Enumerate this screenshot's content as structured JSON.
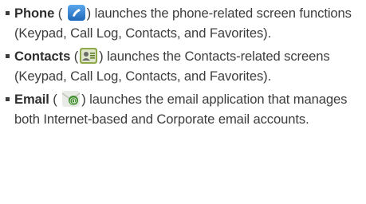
{
  "items": [
    {
      "term": "Phone",
      "open": " ( ",
      "icon": "phone-app-icon",
      "description": ") launches the phone-related screen functions (Keypad, Call Log, Contacts, and Favorites)."
    },
    {
      "term": "Contacts",
      "open": " (",
      "icon": "contacts-app-icon",
      "description": ") launches the Contacts-related screens (Keypad, Call Log, Contacts, and Favorites)."
    },
    {
      "term": "Email",
      "open": " ( ",
      "icon": "email-app-icon",
      "description": ") launches the email application that manages both Internet-based and Corporate email accounts."
    }
  ],
  "colors": {
    "text": "#3c3c3c",
    "phone_icon_bg": "#2f7fd0",
    "contacts_icon_bg": "#7c9a3a",
    "email_icon_accent": "#3d8c2a"
  }
}
